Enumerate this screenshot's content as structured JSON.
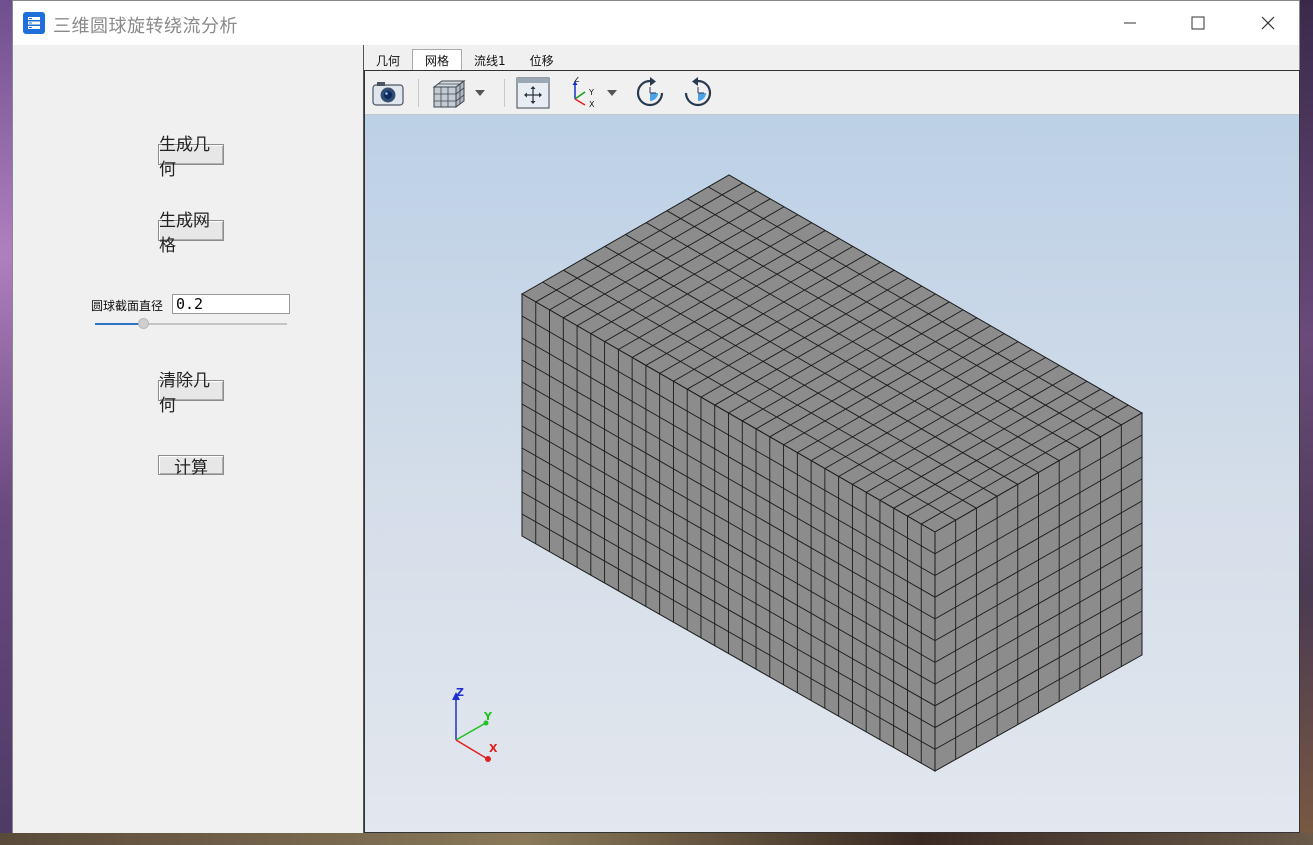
{
  "window": {
    "title": "三维圆球旋转绕流分析"
  },
  "left_panel": {
    "buttons": {
      "generate_geometry": "生成几何",
      "generate_mesh": "生成网格",
      "clear_geometry": "清除几何",
      "compute": "计算"
    },
    "diameter": {
      "label": "圆球截面直径",
      "value": "0.2",
      "slider_fraction": 0.25
    }
  },
  "tabs": [
    "几何",
    "网格",
    "流线1",
    "位移"
  ],
  "active_tab": "网格",
  "toolbar": [
    "camera-icon",
    "mesh-view-icon",
    "dropdown-arrow-icon",
    "fit-view-icon",
    "axes-orient-icon",
    "dropdown-arrow-icon",
    "rotate-cw-icon",
    "rotate-ccw-icon"
  ],
  "axes": {
    "z": "Z",
    "y": "Y",
    "x": "X"
  },
  "colors": {
    "axis_x": "#e02020",
    "axis_y": "#20c020",
    "axis_z": "#2030d0",
    "mesh_face": "#8c8c8c"
  }
}
